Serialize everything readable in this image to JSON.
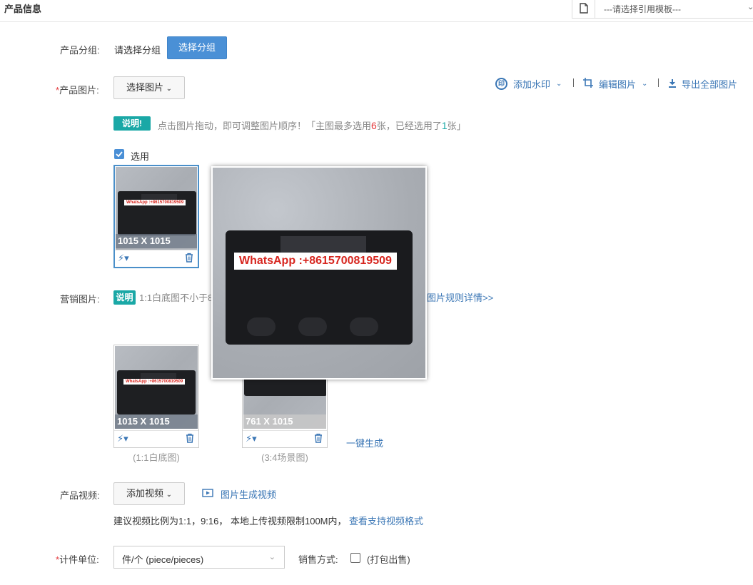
{
  "header": {
    "title": "产品信息",
    "template_select": "---请选择引用模板---"
  },
  "group": {
    "label": "产品分组:",
    "placeholder": "请选择分组",
    "button": "选择分组"
  },
  "images": {
    "required_mark": "*",
    "label": "产品图片:",
    "select_button": "选择图片",
    "tools": {
      "watermark": "添加水印",
      "edit": "编辑图片",
      "export": "导出全部图片"
    },
    "note_badge": "说明!",
    "hint_prefix": "点击图片拖动，即可调整图片顺序！「主图最多选用",
    "hint_max": "6",
    "hint_mid": "张，已经选用了",
    "hint_count": "1",
    "hint_suffix": "张」",
    "use_checkbox_label": "选用",
    "main_thumb_size": "1015 X 1015",
    "watermark_text": "WhatsApp :+8615700819509"
  },
  "marketing": {
    "label": "营销图片:",
    "note_badge": "说明",
    "note_text": "1:1白底图不小于8",
    "rules_link": "图片规则详情>>",
    "cards": [
      {
        "size": "1015 X 1015",
        "caption": "(1:1白底图)"
      },
      {
        "size": "761 X 1015",
        "caption": "(3:4场景图)"
      }
    ],
    "generate_link": "一键生成"
  },
  "video": {
    "label": "产品视频:",
    "add_button": "添加视频",
    "generate_link": "图片生成视频",
    "hint": "建议视频比例为1:1，9:16， 本地上传视频限制100M内，",
    "formats_link": "查看支持视频格式"
  },
  "unit": {
    "required_mark": "*",
    "label": "计件单位:",
    "value": "件/个 (piece/pieces)",
    "sale_label": "销售方式:",
    "pack_label": "(打包出售)"
  },
  "colors": {
    "accent": "#4a90d6",
    "link": "#3a76b5",
    "badge": "#1aa8a6",
    "required": "#e4393c"
  }
}
